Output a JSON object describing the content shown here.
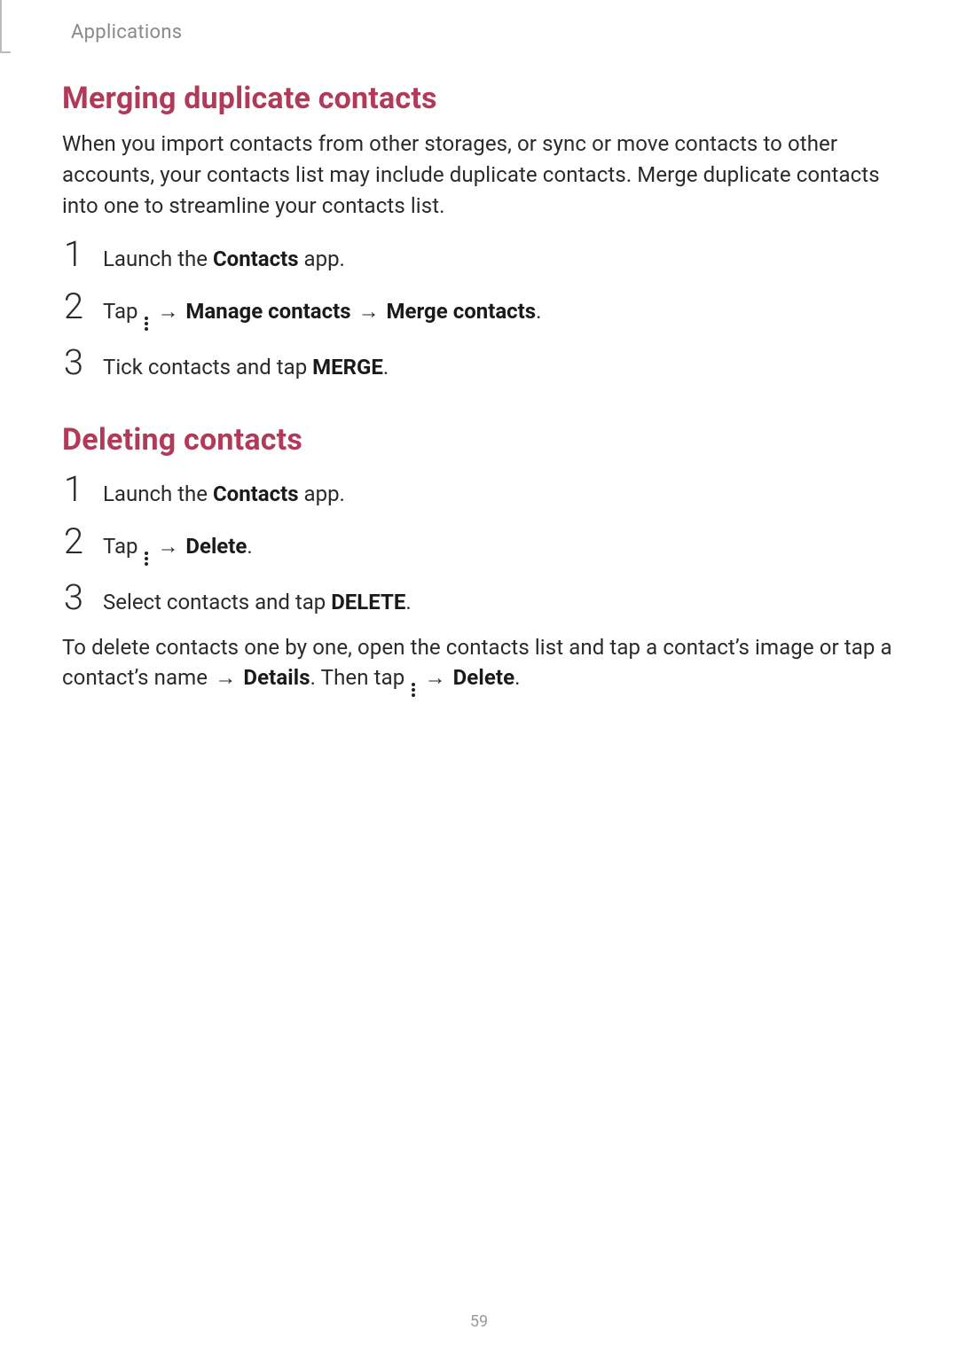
{
  "breadcrumb": "Applications",
  "section1": {
    "title": "Merging duplicate contacts",
    "intro": "When you import contacts from other storages, or sync or move contacts to other accounts, your contacts list may include duplicate contacts. Merge duplicate contacts into one to streamline your contacts list.",
    "steps": [
      {
        "n": "1",
        "pre": "Launch the ",
        "bold": "Contacts",
        "post": " app."
      },
      {
        "n": "2",
        "tap": "Tap ",
        "seq": [
          {
            "icon": "more"
          },
          {
            "arrow": true
          },
          {
            "bold": "Manage contacts"
          },
          {
            "arrow": true
          },
          {
            "bold": "Merge contacts"
          },
          {
            "text": "."
          }
        ]
      },
      {
        "n": "3",
        "pre": "Tick contacts and tap ",
        "bold": "MERGE",
        "post": "."
      }
    ]
  },
  "section2": {
    "title": "Deleting contacts",
    "steps": [
      {
        "n": "1",
        "pre": "Launch the ",
        "bold": "Contacts",
        "post": " app."
      },
      {
        "n": "2",
        "tap": "Tap ",
        "seq": [
          {
            "icon": "more"
          },
          {
            "arrow": true
          },
          {
            "bold": "Delete"
          },
          {
            "text": "."
          }
        ]
      },
      {
        "n": "3",
        "pre": "Select contacts and tap ",
        "bold": "DELETE",
        "post": "."
      }
    ],
    "after": {
      "p1a": "To delete contacts one by one, open the contacts list and tap a contact’s image or tap a contact’s name ",
      "arrow1": "→",
      "details": "Details",
      "p1b": ". Then tap ",
      "arrow2": "→",
      "delete": "Delete",
      "p1c": "."
    }
  },
  "arrow_glyph": "→",
  "page_number": "59"
}
